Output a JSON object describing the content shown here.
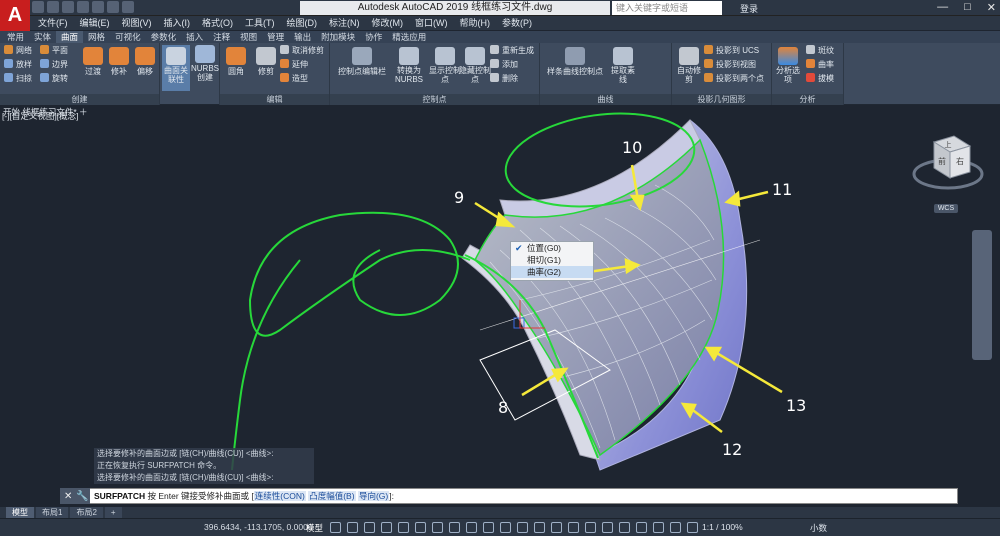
{
  "app": {
    "logo": "A",
    "window_title": "Autodesk AutoCAD 2019   线框练习文件.dwg",
    "search_placeholder": "键入关键字或短语",
    "login": "登录",
    "win_controls": [
      "—",
      "□",
      "✕"
    ]
  },
  "menu": [
    "文件(F)",
    "编辑(E)",
    "视图(V)",
    "插入(I)",
    "格式(O)",
    "工具(T)",
    "绘图(D)",
    "标注(N)",
    "修改(M)",
    "窗口(W)",
    "帮助(H)",
    "参数(P)"
  ],
  "tabs": [
    {
      "label": "常用",
      "active": false
    },
    {
      "label": "实体",
      "active": false
    },
    {
      "label": "曲面",
      "active": true
    },
    {
      "label": "网格",
      "active": false
    },
    {
      "label": "可视化",
      "active": false
    },
    {
      "label": "参数化",
      "active": false
    },
    {
      "label": "插入",
      "active": false
    },
    {
      "label": "注释",
      "active": false
    },
    {
      "label": "视图",
      "active": false
    },
    {
      "label": "管理",
      "active": false
    },
    {
      "label": "输出",
      "active": false
    },
    {
      "label": "附加模块",
      "active": false
    },
    {
      "label": "协作",
      "active": false
    },
    {
      "label": "精选应用",
      "active": false
    }
  ],
  "ribbon": {
    "create": {
      "title": "创建",
      "small": [
        "网络",
        "平面",
        "放样",
        "边界",
        "扫掠",
        "旋转"
      ],
      "buttons": [
        "过渡",
        "修补",
        "偏移",
        "曲面关联性",
        "NURBS创建"
      ]
    },
    "edit": {
      "title": "编辑",
      "buttons": [
        "圆角",
        "修剪"
      ],
      "small": [
        "取消修剪",
        "延伸",
        "造型"
      ]
    },
    "controlpoints": {
      "title": "控制点",
      "buttons": [
        "控制点编辑栏",
        "转换为NURBS",
        "显示控制点",
        "隐藏控制点"
      ],
      "small": [
        "重新生成",
        "添加",
        "删除"
      ]
    },
    "curves": {
      "title": "曲线",
      "buttons": [
        "样条曲线控制点",
        "提取素线"
      ]
    },
    "project": {
      "title": "投影几何图形",
      "buttons": [
        "自动修剪"
      ],
      "small": [
        "投影到 UCS",
        "投影到视图",
        "投影到两个点"
      ]
    },
    "analysis": {
      "title": "分析",
      "buttons": [
        "分析选项"
      ],
      "small": [
        "斑纹",
        "曲率",
        "拔模"
      ]
    }
  },
  "file_tab": "开始   线框练习文件*   ＋",
  "view_label": "[-][自定义视图][概念]",
  "viewcube": {
    "top": "上",
    "front": "前",
    "right": "右",
    "wcs": "WCS"
  },
  "context_menu": [
    {
      "label": "位置(G0)",
      "checked": true,
      "selected": false
    },
    {
      "label": "相切(G1)",
      "checked": false,
      "selected": false
    },
    {
      "label": "曲率(G2)",
      "checked": false,
      "selected": true
    }
  ],
  "callouts": [
    "8",
    "9",
    "10",
    "11",
    "12",
    "13"
  ],
  "command_history": [
    "选择要修补的曲面边或 [链(CH)/曲线(CU)] <曲线>:",
    "正在恢复执行 SURFPATCH 命令。",
    "选择要修补的曲面边或 [链(CH)/曲线(CU)] <曲线>:"
  ],
  "command": {
    "name": "SURFPATCH",
    "prompt": " 按 Enter 键接受修补曲面或 [",
    "opt1": "连续性(CON)",
    "opt2": "凸度幅值(B)",
    "opt3": "导向(G)",
    "end": "]:"
  },
  "layout_tabs": [
    {
      "label": "模型",
      "active": true
    },
    {
      "label": "布局1",
      "active": false
    },
    {
      "label": "布局2",
      "active": false
    },
    {
      "label": "+",
      "active": false
    }
  ],
  "status": {
    "coords": "396.6434, -113.1705, 0.0000",
    "model": "模型",
    "zoom": "1:1 / 100%",
    "units": "小数"
  },
  "colors": {
    "accent": "#c81e1e",
    "wire": "#27d83a",
    "surface": "#8d8fd6",
    "callout": "#f5e93a"
  }
}
